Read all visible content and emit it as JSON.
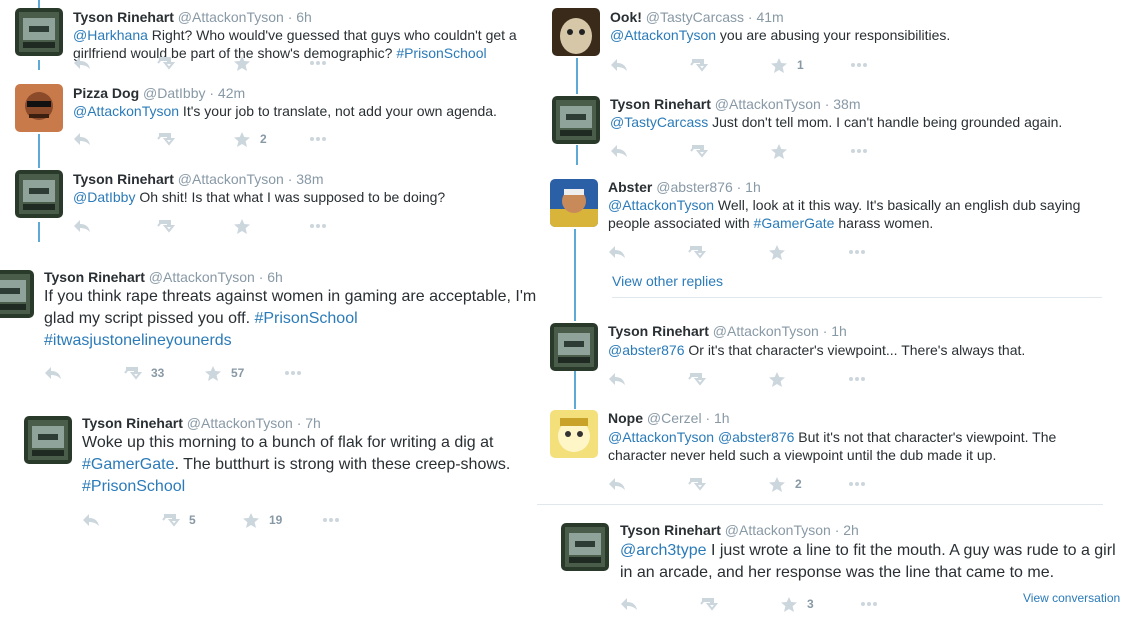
{
  "tweets": [
    {
      "name": "Tyson Rinehart",
      "handle": "@AttackonTyson",
      "time": "· 6h",
      "parts": [
        {
          "t": "@Harkhana",
          "l": true
        },
        {
          "t": " Right? Who would've guessed that guys who couldn't get a"
        },
        {
          "t": "girlfriend would be part of the show's demographic? ",
          "br": true
        },
        {
          "t": "#PrisonSchool",
          "l": true
        }
      ],
      "retweets": "",
      "favorites": ""
    },
    {
      "name": "Pizza Dog",
      "handle": "@DatIbby",
      "time": "· 42m",
      "parts": [
        {
          "t": "@AttackonTyson",
          "l": true
        },
        {
          "t": " It's your job to translate, not add your own agenda."
        }
      ],
      "retweets": "",
      "favorites": "2"
    },
    {
      "name": "Tyson Rinehart",
      "handle": "@AttackonTyson",
      "time": "· 38m",
      "parts": [
        {
          "t": "@DatIbby",
          "l": true
        },
        {
          "t": " Oh shit! Is that what I was supposed to be doing?"
        }
      ],
      "retweets": "",
      "favorites": ""
    },
    {
      "name": "Tyson Rinehart",
      "handle": "@AttackonTyson",
      "time": "· 6h",
      "parts": [
        {
          "t": "If you think rape threats against women in gaming are acceptable, I'm"
        },
        {
          "t": "glad my script pissed you off. ",
          "br": true
        },
        {
          "t": "#PrisonSchool",
          "l": true
        },
        {
          "t": "#itwasjustonelineyounerds",
          "l": true,
          "br": true
        }
      ],
      "retweets": "33",
      "favorites": "57"
    },
    {
      "name": "Tyson Rinehart",
      "handle": "@AttackonTyson",
      "time": "· 7h",
      "parts": [
        {
          "t": "Woke up this morning to a bunch of flak for writing a dig at"
        },
        {
          "t": "#GamerGate",
          "l": true,
          "br": true
        },
        {
          "t": ". The butthurt is strong with these creep-shows."
        },
        {
          "t": "#PrisonSchool",
          "l": true,
          "br": true
        }
      ],
      "retweets": "5",
      "favorites": "19"
    },
    {
      "name": "Ook!",
      "handle": "@TastyCarcass",
      "time": "· 41m",
      "parts": [
        {
          "t": "@AttackonTyson",
          "l": true
        },
        {
          "t": " you are abusing your responsibilities."
        }
      ],
      "retweets": "",
      "favorites": "1"
    },
    {
      "name": "Tyson Rinehart",
      "handle": "@AttackonTyson",
      "time": "· 38m",
      "parts": [
        {
          "t": "@TastyCarcass",
          "l": true
        },
        {
          "t": " Just don't tell mom. I can't handle being grounded again."
        }
      ],
      "retweets": "",
      "favorites": ""
    },
    {
      "name": "Abster",
      "handle": "@abster876",
      "time": "· 1h",
      "parts": [
        {
          "t": "@AttackonTyson",
          "l": true
        },
        {
          "t": " Well, look at it this way.  It's basically an english dub saying"
        },
        {
          "t": "people associated with ",
          "br": true
        },
        {
          "t": "#GamerGate",
          "l": true
        },
        {
          "t": " harass women."
        }
      ],
      "retweets": "",
      "favorites": ""
    },
    {
      "name": "Tyson Rinehart",
      "handle": "@AttackonTyson",
      "time": "· 1h",
      "parts": [
        {
          "t": "@abster876",
          "l": true
        },
        {
          "t": " Or it's that character's viewpoint... There's always that."
        }
      ],
      "retweets": "",
      "favorites": ""
    },
    {
      "name": "Nope",
      "handle": "@Cerzel",
      "time": "· 1h",
      "parts": [
        {
          "t": "@AttackonTyson",
          "l": true
        },
        {
          "t": " "
        },
        {
          "t": "@abster876",
          "l": true
        },
        {
          "t": " But it's not that character's viewpoint. The"
        },
        {
          "t": "character never held such a viewpoint until the dub made it up.",
          "br": true
        }
      ],
      "retweets": "",
      "favorites": "2"
    },
    {
      "name": "Tyson Rinehart",
      "handle": "@AttackonTyson",
      "time": "· 2h",
      "parts": [
        {
          "t": "@arch3type",
          "l": true
        },
        {
          "t": " I just wrote a line to fit the mouth. A guy was rude to a girl"
        },
        {
          "t": "in an arcade, and her response was the line that came to me.",
          "br": true
        }
      ],
      "retweets": "",
      "favorites": "3"
    }
  ],
  "view_other_replies": "View other replies",
  "view_conversation": "View conversation",
  "icons": {
    "reply": "reply-icon",
    "retweet": "retweet-icon",
    "favorite": "favorite-star-icon",
    "more": "more-dots-icon"
  },
  "colors": {
    "link": "#2b7bb9",
    "thread": "#5fa9d6",
    "muted": "#8899a6",
    "action": "#ccd6dd"
  }
}
